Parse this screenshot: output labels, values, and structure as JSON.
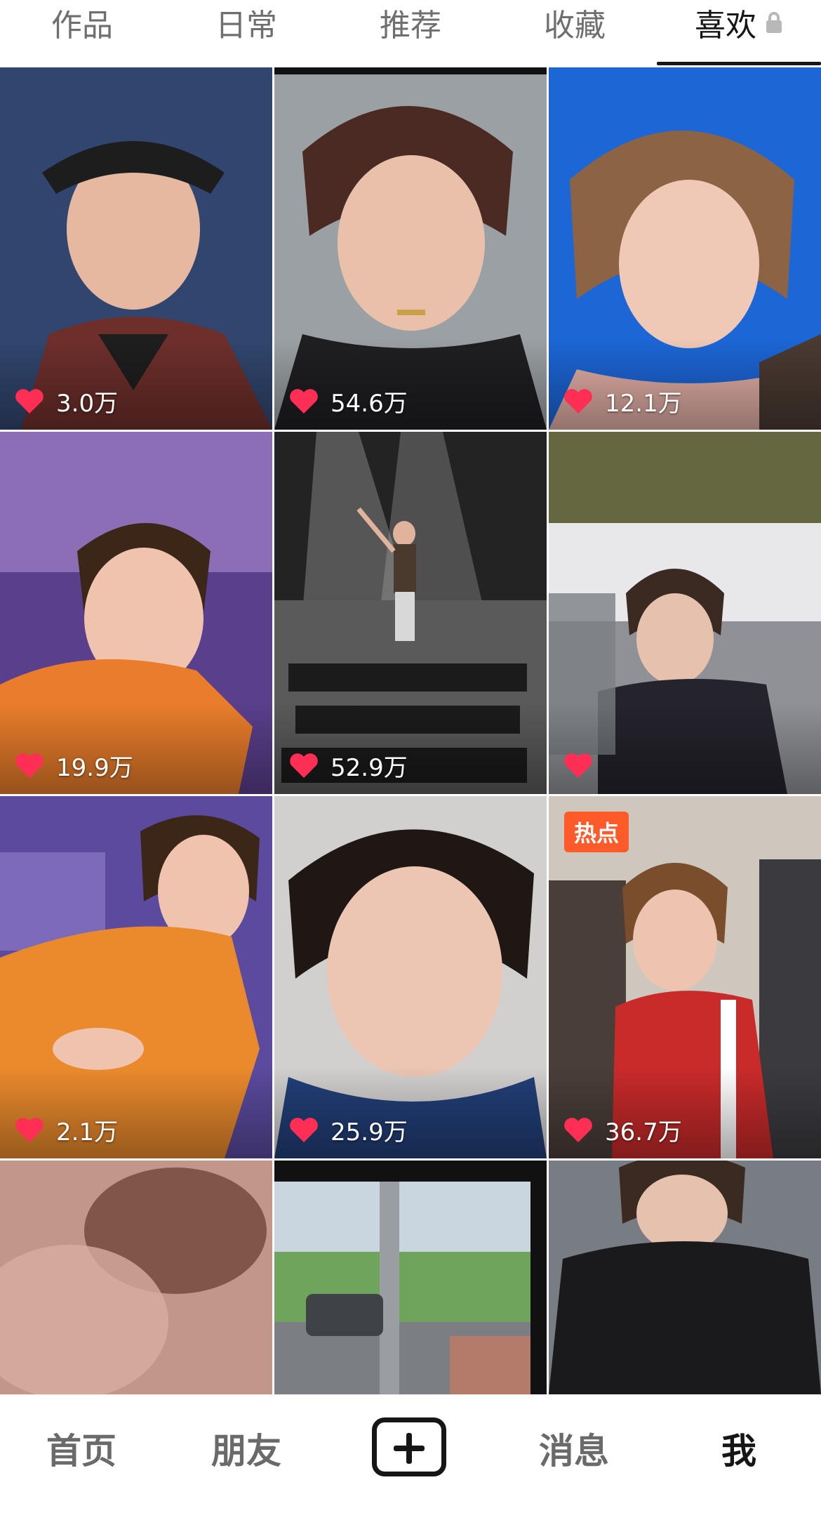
{
  "tabs": [
    {
      "label": "作品",
      "active": false
    },
    {
      "label": "日常",
      "active": false
    },
    {
      "label": "推荐",
      "active": false
    },
    {
      "label": "收藏",
      "active": false
    },
    {
      "label": "喜欢",
      "active": true,
      "locked": true
    }
  ],
  "videos": [
    {
      "likes": "3.0万",
      "badge": "",
      "theme": [
        "#3a4f7a",
        "#7a3b2f"
      ]
    },
    {
      "likes": "54.6万",
      "badge": "",
      "theme": [
        "#9aa1a6",
        "#2a2a2a"
      ]
    },
    {
      "likes": "12.1万",
      "badge": "",
      "theme": [
        "#1f6ad8",
        "#b88b69"
      ]
    },
    {
      "likes": "19.9万",
      "badge": "",
      "theme": [
        "#5b3c8c",
        "#e47a2c"
      ]
    },
    {
      "likes": "52.9万",
      "badge": "",
      "theme": [
        "#2a2a2a",
        "#8a8a8a"
      ]
    },
    {
      "likes": "",
      "badge": "",
      "theme": [
        "#6d6c4b",
        "#2b2b34"
      ]
    },
    {
      "likes": "2.1万",
      "badge": "",
      "theme": [
        "#5a4a9a",
        "#e58b30"
      ]
    },
    {
      "likes": "25.9万",
      "badge": "",
      "theme": [
        "#cfcdcb",
        "#254a8a"
      ]
    },
    {
      "likes": "36.7万",
      "badge": "热点",
      "theme": [
        "#c8c2b8",
        "#c52b2b"
      ]
    },
    {
      "likes": "",
      "badge": "",
      "theme": [
        "#b58a7f",
        "#6d4a3e"
      ]
    },
    {
      "likes": "",
      "badge": "",
      "theme": [
        "#7fae6a",
        "#6a6e72"
      ]
    },
    {
      "likes": "",
      "badge": "",
      "theme": [
        "#7a7f86",
        "#1c1c1c"
      ]
    }
  ],
  "bottom_nav": {
    "home": "首页",
    "friends": "朋友",
    "messages": "消息",
    "me": "我"
  },
  "colors": {
    "heart": "#ff2e55",
    "hot_badge": "#ff5a2a",
    "active_text": "#161616",
    "inactive_text": "#6f6f6f"
  }
}
